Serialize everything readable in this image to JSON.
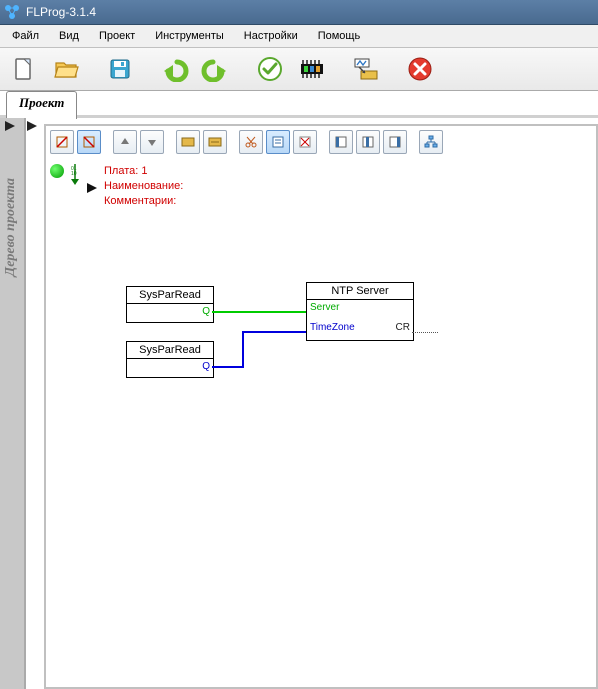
{
  "window": {
    "title": "FLProg-3.1.4"
  },
  "menubar": {
    "items": [
      "Файл",
      "Вид",
      "Проект",
      "Инструменты",
      "Настройки",
      "Помощь"
    ]
  },
  "main_toolbar": {
    "buttons": [
      {
        "name": "new",
        "icon": "file-new"
      },
      {
        "name": "open",
        "icon": "folder-open"
      },
      {
        "name": "save",
        "icon": "save"
      },
      {
        "name": "undo",
        "icon": "undo"
      },
      {
        "name": "redo",
        "icon": "redo"
      },
      {
        "name": "check",
        "icon": "check"
      },
      {
        "name": "compile",
        "icon": "chip"
      },
      {
        "name": "upload",
        "icon": "upload-board"
      },
      {
        "name": "stop",
        "icon": "close-red"
      }
    ]
  },
  "tab": {
    "label": "Проект"
  },
  "sidebar": {
    "label": "Дерево проекта"
  },
  "canvas_toolbar": {
    "buttons": [
      {
        "name": "compile-disable",
        "icon": "ct1"
      },
      {
        "name": "compile-enable",
        "icon": "ct2",
        "selected": true
      },
      {
        "name": "move-up",
        "icon": "arrow-up"
      },
      {
        "name": "move-down",
        "icon": "arrow-down"
      },
      {
        "name": "board1",
        "icon": "board-a"
      },
      {
        "name": "board2",
        "icon": "board-b"
      },
      {
        "name": "cut",
        "icon": "scissors"
      },
      {
        "name": "note",
        "icon": "note",
        "selected": true
      },
      {
        "name": "del-note",
        "icon": "del-note"
      },
      {
        "name": "page-first",
        "icon": "page-first"
      },
      {
        "name": "page-prev",
        "icon": "page-prev"
      },
      {
        "name": "page-next",
        "icon": "page-next"
      },
      {
        "name": "tree",
        "icon": "tree"
      }
    ]
  },
  "info": {
    "board_label": "Плата:",
    "board_value": "1",
    "name_label": "Наименование:",
    "comment_label": "Комментарии:"
  },
  "diagram": {
    "blocks": [
      {
        "id": "b1",
        "title": "SysParRead",
        "pins_right": [
          "Q"
        ]
      },
      {
        "id": "b2",
        "title": "SysParRead",
        "pins_right": [
          "Q"
        ]
      },
      {
        "id": "b3",
        "title": "NTP Server",
        "pins_left": [
          "Server",
          "TimeZone"
        ],
        "pins_right": [
          "CR"
        ]
      }
    ]
  }
}
